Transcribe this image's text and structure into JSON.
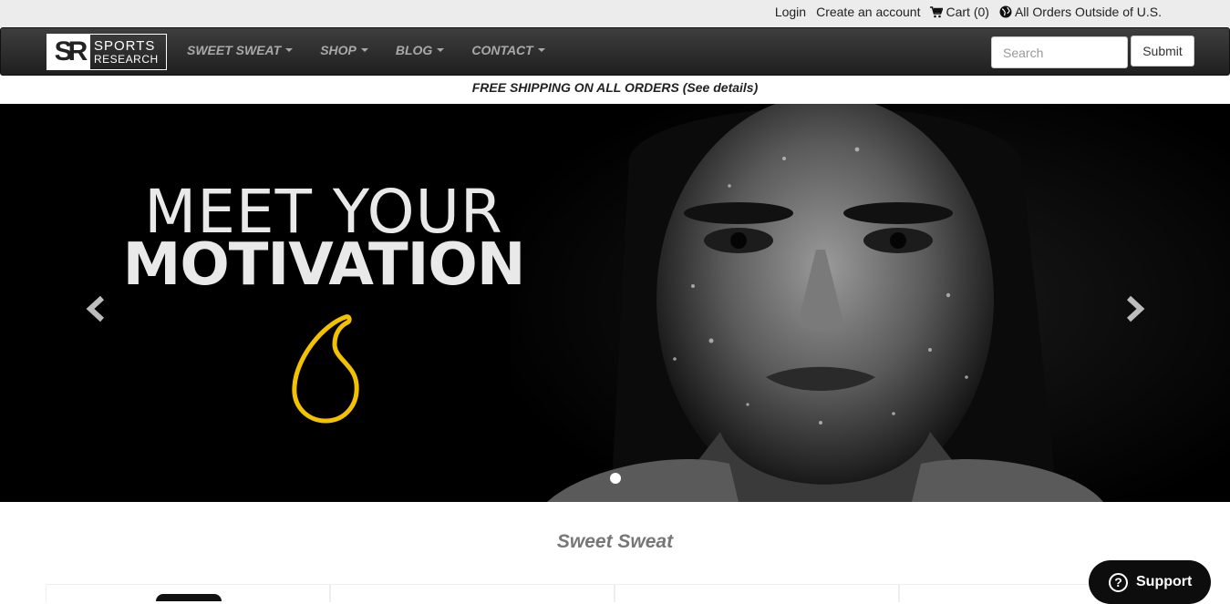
{
  "topbar": {
    "login": "Login",
    "create_account": "Create an account",
    "cart": "Cart (0)",
    "orders_outside": "All Orders Outside of U.S."
  },
  "logo": {
    "line1": "SPORTS",
    "line2": "RESEARCH",
    "mark": "SR"
  },
  "nav": {
    "items": [
      {
        "label": "SWEET SWEAT"
      },
      {
        "label": "SHOP"
      },
      {
        "label": "BLOG"
      },
      {
        "label": "CONTACT"
      }
    ],
    "search_placeholder": "Search",
    "submit_label": "Submit"
  },
  "shipping": {
    "text": "FREE SHIPPING ON ALL ORDERS",
    "details": "(See details)"
  },
  "hero": {
    "line1": "MEET YOUR",
    "line2": "MOTIVATION",
    "accent_color": "#f2c200"
  },
  "section": {
    "title": "Sweet Sweat"
  },
  "support": {
    "label": "Support"
  }
}
